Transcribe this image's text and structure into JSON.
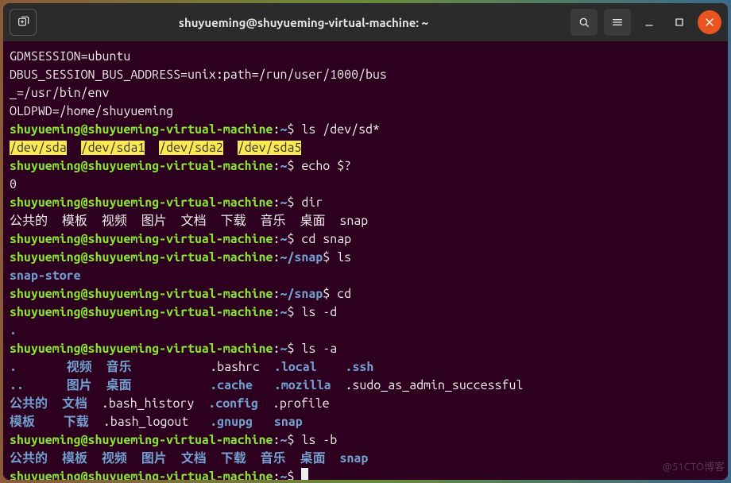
{
  "window": {
    "title": "shuyueming@shuyueming-virtual-machine: ~"
  },
  "icons": {
    "newtab": "new-tab-icon",
    "search": "search-icon",
    "menu": "hamburger-icon",
    "minimize": "minimize-icon",
    "maximize": "maximize-icon",
    "close": "close-icon"
  },
  "prompt": {
    "userhost": "shuyueming@shuyueming-virtual-machine",
    "sep": ":",
    "path_home": "~",
    "path_snap": "~/snap",
    "sigil": "$"
  },
  "env": {
    "l1": "GDMSESSION=ubuntu",
    "l2": "DBUS_SESSION_BUS_ADDRESS=unix:path=/run/user/1000/bus",
    "l3": "_=/usr/bin/env",
    "l4": "OLDPWD=/home/shuyueming"
  },
  "cmds": {
    "ls_sd": " ls /dev/sd*",
    "echo_q": " echo $?",
    "dir": " dir",
    "cd_snap": " cd snap",
    "ls": " ls",
    "cd": " cd",
    "ls_d": " ls -d",
    "ls_a": " ls -a",
    "ls_b": " ls -b",
    "blank": " "
  },
  "out": {
    "sd": {
      "a": "/dev/sda",
      "a1": "/dev/sda1",
      "a2": "/dev/sda2",
      "a5": "/dev/sda5",
      "gap": "  "
    },
    "echo_q": "0",
    "dir_line": "公共的  模板  视频  图片  文档  下载  音乐  桌面  snap",
    "snap_ls": "snap-store",
    "ls_d": ".",
    "ls_a": {
      "r1": {
        "c1": ".",
        "c2": "视频",
        "c3": "音乐",
        "c4": "       ",
        "c5": ".bashrc",
        "c6": ".local",
        "c7": ".ssh"
      },
      "r2": {
        "c1": "..",
        "c2": "图片",
        "c3": "桌面",
        "c4": "       ",
        "c5": ".cache",
        "c6": ".mozilla",
        "c7": ".sudo_as_admin_successful"
      },
      "r3": {
        "c1": "公共的",
        "c2": "文档",
        "c3": ".bash_history",
        "c5": ".config",
        "c6": ".profile"
      },
      "r4": {
        "c1": "模板",
        "c2": "下载",
        "c3": ".bash_logout",
        "c5": ".gnupg",
        "c6": "snap"
      }
    },
    "ls_b": {
      "d1": "公共的",
      "d2": "模板",
      "d3": "视频",
      "d4": "图片",
      "d5": "文档",
      "d6": "下载",
      "d7": "音乐",
      "d8": "桌面",
      "snap": "snap",
      "gap": "  "
    }
  },
  "watermark": "@51CTO博客"
}
